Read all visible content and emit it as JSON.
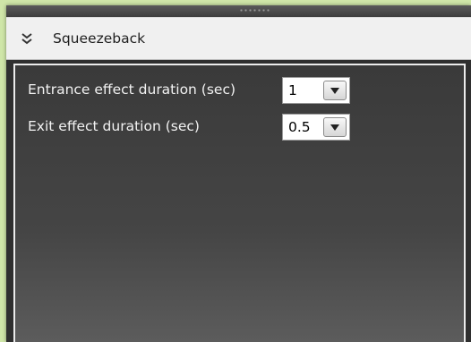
{
  "panel": {
    "title": "Squeezeback",
    "collapse_icon": "double-chevron-down-icon"
  },
  "settings": [
    {
      "label": "Entrance effect duration (sec)",
      "value": "1",
      "dropdown_icon": "chevron-down-icon"
    },
    {
      "label": "Exit effect duration (sec)",
      "value": "0.5",
      "dropdown_icon": "chevron-down-icon"
    }
  ],
  "colors": {
    "header_bg": "#f0f0f0",
    "panel_bg": "#3a3a3a",
    "label_text": "#f2f2f2",
    "outer_bg": "#cfe6a8"
  }
}
